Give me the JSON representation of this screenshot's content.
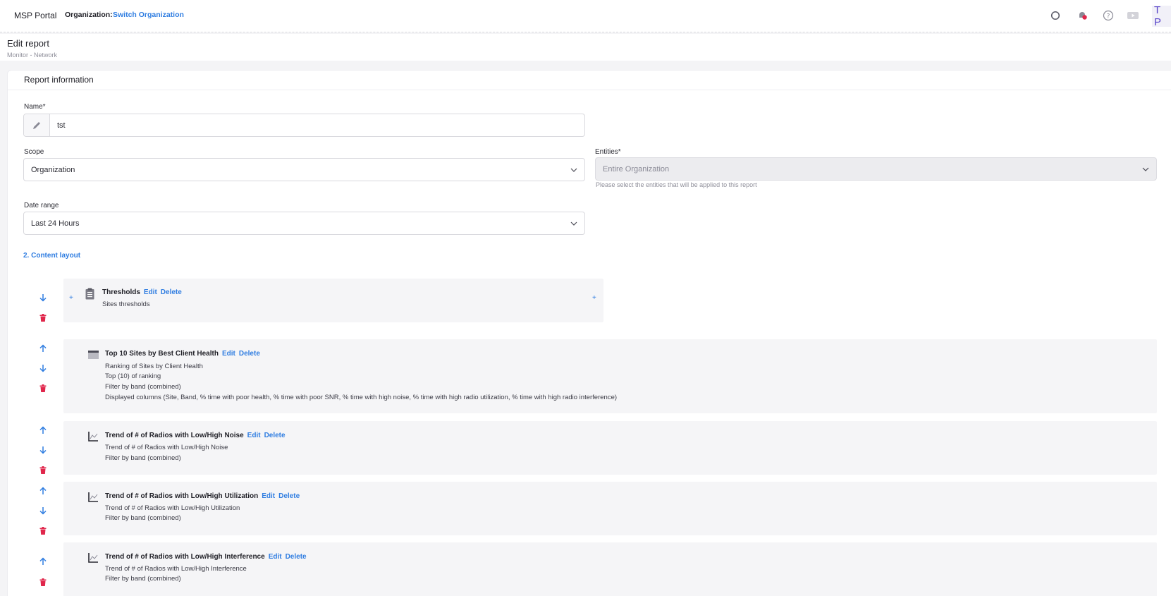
{
  "topbar": {
    "brand": "MSP Portal",
    "org_label": "Organization:",
    "org_switch": "Switch Organization",
    "avatar": "T P",
    "icons": [
      "search-icon",
      "notifications-icon",
      "help-icon",
      "video-icon"
    ]
  },
  "header": {
    "title": "Edit report",
    "breadcrumb": "Monitor - Network"
  },
  "report_info": {
    "title": "Report information",
    "name_label": "Name*",
    "name_value": "tst",
    "scope_label": "Scope",
    "scope_value": "Organization",
    "entities_label": "Entities*",
    "entities_value": "Entire Organization",
    "entities_hint": "Please select the entities that will be applied to this report",
    "date_label": "Date range",
    "date_value": "Last 24 Hours"
  },
  "content_layout": {
    "title": "2. Content layout",
    "edit_label": "Edit",
    "delete_label": "Delete",
    "plus": "+",
    "items": [
      {
        "title": "Thresholds",
        "icon": "clipboard-icon",
        "lines": [
          "Sites thresholds"
        ]
      },
      {
        "title": "Top 10 Sites by Best Client Health",
        "icon": "table-icon",
        "lines": [
          "Ranking of Sites by Client Health",
          "Top (10) of ranking",
          "Filter by band (combined)",
          "Displayed columns (Site, Band, % time with poor health, % time with poor SNR, % time with high noise, % time with high radio utilization, % time with high radio interference)"
        ]
      },
      {
        "title": "Trend of # of Radios with Low/High Noise",
        "icon": "line-chart-icon",
        "lines": [
          "Trend of # of Radios with Low/High Noise",
          "Filter by band (combined)"
        ]
      },
      {
        "title": "Trend of # of Radios with Low/High Utilization",
        "icon": "line-chart-icon",
        "lines": [
          "Trend of # of Radios with Low/High Utilization",
          "Filter by band (combined)"
        ]
      },
      {
        "title": "Trend of # of Radios with Low/High Interference",
        "icon": "line-chart-icon",
        "lines": [
          "Trend of # of Radios with Low/High Interference",
          "Filter by band (combined)"
        ]
      }
    ]
  }
}
